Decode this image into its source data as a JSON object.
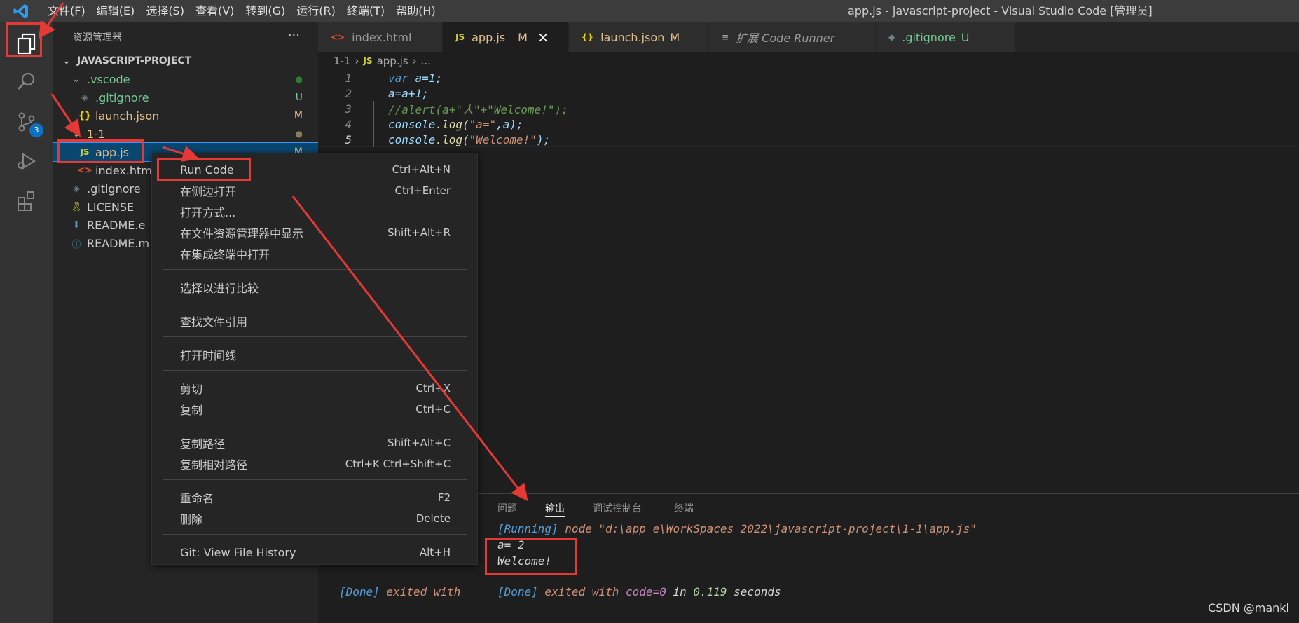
{
  "titlebar": {
    "menus": [
      "文件(F)",
      "编辑(E)",
      "选择(S)",
      "查看(V)",
      "转到(G)",
      "运行(R)",
      "终端(T)",
      "帮助(H)"
    ],
    "window_title": "app.js - javascript-project - Visual Studio Code [管理员]"
  },
  "activitybar": {
    "scm_badge": "3"
  },
  "sidebar": {
    "title": "资源管理器",
    "more": "···",
    "project": "JAVASCRIPT-PROJECT",
    "tree": [
      {
        "label": ".vscode",
        "icon": "chevron-down",
        "status": "●"
      },
      {
        "label": ".gitignore",
        "icon": "diamond",
        "status": "U"
      },
      {
        "label": "launch.json",
        "icon": "{}",
        "status": "M"
      },
      {
        "label": "1-1",
        "icon": "chevron-down",
        "status": "●"
      },
      {
        "label": "app.js",
        "icon": "JS",
        "status": "M"
      },
      {
        "label": "index.htm",
        "icon": "<>",
        "status": ""
      },
      {
        "label": ".gitignore",
        "icon": "diamond",
        "status": ""
      },
      {
        "label": "LICENSE",
        "icon": "key",
        "status": ""
      },
      {
        "label": "README.e",
        "icon": "arrow-down",
        "status": ""
      },
      {
        "label": "README.m",
        "icon": "info",
        "status": ""
      }
    ]
  },
  "tabs": [
    {
      "label": "index.html",
      "icon": "<>",
      "mark": ""
    },
    {
      "label": "app.js",
      "icon": "JS",
      "mark": "M",
      "close": "×"
    },
    {
      "label": "launch.json",
      "icon": "{}",
      "mark": "M"
    },
    {
      "label": "扩展 Code Runner",
      "icon": "≡",
      "mark": ""
    },
    {
      "label": ".gitignore",
      "icon": "◆",
      "mark": "U"
    }
  ],
  "breadcrumb": {
    "folder": "1-1",
    "file_icon": "JS",
    "file": "app.js",
    "more": "..."
  },
  "editor": {
    "lines": [
      {
        "num": "1"
      },
      {
        "num": "2"
      },
      {
        "num": "3"
      },
      {
        "num": "4"
      },
      {
        "num": "5"
      }
    ],
    "code": {
      "l1_kw": "var",
      "l1_rest": " a=1;",
      "l2": "a=a+1;",
      "l3": "//alert(a+\"人\"+\"Welcome!\");",
      "l4_obj": "console",
      "l4_fn": ".log(",
      "l4_str": "\"a=\"",
      "l4_rest": ",a);",
      "l5_obj": "console",
      "l5_fn": ".log(",
      "l5_str": "\"Welcome!\"",
      "l5_rest": ");"
    }
  },
  "panel": {
    "tabs": [
      "问题",
      "输出",
      "调试控制台",
      "终端"
    ],
    "running_tag": "[Running]",
    "running_cmd": " node \"d:\\app_e\\WorkSpaces_2022\\javascript-project\\1-1\\app.js\"",
    "out1": "a= 2",
    "out2": "Welcome!",
    "done_tag": "[Done]",
    "done_text": " exited with ",
    "done_tag2": "[Done]",
    "done_text2": " exited with ",
    "done_code": "code=0",
    "done_in": " in ",
    "done_secs": "0.119",
    "done_unit": " seconds"
  },
  "context_menu": {
    "items": [
      {
        "label": "Run Code",
        "kb": "Ctrl+Alt+N"
      },
      {
        "label": "在侧边打开",
        "kb": "Ctrl+Enter"
      },
      {
        "label": "打开方式...",
        "kb": ""
      },
      {
        "label": "在文件资源管理器中显示",
        "kb": "Shift+Alt+R"
      },
      {
        "label": "在集成终端中打开",
        "kb": ""
      },
      {
        "label": "选择以进行比较",
        "kb": ""
      },
      {
        "label": "查找文件引用",
        "kb": ""
      },
      {
        "label": "打开时间线",
        "kb": ""
      },
      {
        "label": "剪切",
        "kb": "Ctrl+X"
      },
      {
        "label": "复制",
        "kb": "Ctrl+C"
      },
      {
        "label": "复制路径",
        "kb": "Shift+Alt+C"
      },
      {
        "label": "复制相对路径",
        "kb": "Ctrl+K Ctrl+Shift+C"
      },
      {
        "label": "重命名",
        "kb": "F2"
      },
      {
        "label": "删除",
        "kb": "Delete"
      },
      {
        "label": "Git: View File History",
        "kb": "Alt+H"
      }
    ]
  },
  "colors": {
    "accent": "#007acc",
    "annotation": "#e53935"
  },
  "watermark": "CSDN @mankl"
}
